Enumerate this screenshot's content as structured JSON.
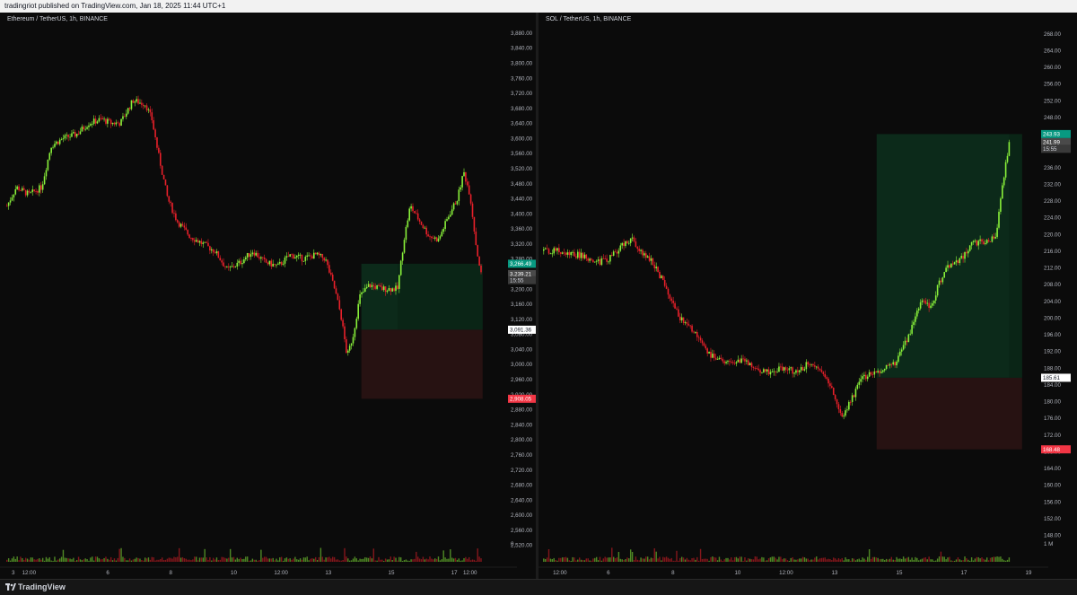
{
  "header": {
    "text": "tradingriot published on TradingView.com, Jan 18, 2025 11:44 UTC+1"
  },
  "footer": {
    "brand": "TradingView"
  },
  "colors": {
    "up": "#89f13a",
    "down": "#e8202a",
    "bg": "#0b0b0b",
    "tp_zone": "#0c2e1c",
    "sl_zone": "#2a1313",
    "axis_text": "#b2b5be"
  },
  "chart_data": [
    {
      "type": "candlestick",
      "title": "Ethereum / TetherUS, 1h, BINANCE",
      "ylim": [
        2480,
        3900
      ],
      "yticks": [
        "3,880.00",
        "3,840.00",
        "3,800.00",
        "3,760.00",
        "3,720.00",
        "3,680.00",
        "3,640.00",
        "3,600.00",
        "3,560.00",
        "3,520.00",
        "3,480.00",
        "3,440.00",
        "3,400.00",
        "3,360.00",
        "3,320.00",
        "3,280.00",
        "3,240.00",
        "3,200.00",
        "3,160.00",
        "3,120.00",
        "3,080.00",
        "3,040.00",
        "3,000.00",
        "2,960.00",
        "2,920.00",
        "2,880.00",
        "2,840.00",
        "2,800.00",
        "2,760.00",
        "2,720.00",
        "2,680.00",
        "2,640.00",
        "2,600.00",
        "2,560.00",
        "2,520.00"
      ],
      "volume_label": "0",
      "xticks": [
        {
          "label": "3",
          "day": 3
        },
        {
          "label": "12:00",
          "day": 3.5
        },
        {
          "label": "6",
          "day": 6
        },
        {
          "label": "8",
          "day": 8
        },
        {
          "label": "10",
          "day": 10
        },
        {
          "label": "12:00",
          "day": 11.5
        },
        {
          "label": "13",
          "day": 13
        },
        {
          "label": "15",
          "day": 15
        },
        {
          "label": "17",
          "day": 17
        },
        {
          "label": "12:00",
          "day": 17.5
        }
      ],
      "x_start_day": 2.75,
      "x_end_day": 17.85,
      "path": [
        [
          2.8,
          3420
        ],
        [
          3.1,
          3470
        ],
        [
          3.5,
          3450
        ],
        [
          3.9,
          3470
        ],
        [
          4.2,
          3580
        ],
        [
          4.6,
          3600
        ],
        [
          5.0,
          3610
        ],
        [
          5.4,
          3640
        ],
        [
          5.8,
          3650
        ],
        [
          6.1,
          3640
        ],
        [
          6.4,
          3640
        ],
        [
          6.8,
          3700
        ],
        [
          7.2,
          3690
        ],
        [
          7.4,
          3650
        ],
        [
          7.6,
          3560
        ],
        [
          7.9,
          3440
        ],
        [
          8.2,
          3380
        ],
        [
          8.6,
          3340
        ],
        [
          9.0,
          3320
        ],
        [
          9.4,
          3300
        ],
        [
          9.8,
          3250
        ],
        [
          10.2,
          3270
        ],
        [
          10.6,
          3300
        ],
        [
          11.0,
          3270
        ],
        [
          11.4,
          3260
        ],
        [
          11.8,
          3290
        ],
        [
          12.2,
          3280
        ],
        [
          12.6,
          3290
        ],
        [
          12.9,
          3280
        ],
        [
          13.2,
          3200
        ],
        [
          13.4,
          3130
        ],
        [
          13.6,
          3020
        ],
        [
          13.8,
          3080
        ],
        [
          14.0,
          3180
        ],
        [
          14.3,
          3210
        ],
        [
          14.7,
          3200
        ],
        [
          15.0,
          3200
        ],
        [
          15.2,
          3200
        ],
        [
          15.4,
          3330
        ],
        [
          15.6,
          3420
        ],
        [
          15.9,
          3380
        ],
        [
          16.2,
          3340
        ],
        [
          16.5,
          3330
        ],
        [
          16.8,
          3390
        ],
        [
          17.1,
          3440
        ],
        [
          17.3,
          3510
        ],
        [
          17.5,
          3450
        ],
        [
          17.7,
          3310
        ],
        [
          17.85,
          3239
        ]
      ],
      "position": {
        "start_day": 14.05,
        "end_day": 17.9,
        "entry": 3091.36,
        "target": 3266.49,
        "stop": 2908.05,
        "split_day": 15.2
      },
      "price_labels": [
        {
          "text": "3,266.49",
          "price": 3266.49,
          "kind": "green"
        },
        {
          "text": "3,239.21",
          "price": 3239.21,
          "kind": "gray"
        },
        {
          "text": "15:55",
          "price": 3223,
          "kind": "gray2"
        },
        {
          "text": "3,091.36",
          "price": 3091.36,
          "kind": "white"
        },
        {
          "text": "2,908.05",
          "price": 2908.05,
          "kind": "red"
        }
      ]
    },
    {
      "type": "candlestick",
      "title": "SOL / TetherUS, 1h, BINANCE",
      "ylim": [
        142,
        270
      ],
      "yticks": [
        "268.00",
        "264.00",
        "260.00",
        "256.00",
        "252.00",
        "248.00",
        "244.00",
        "240.00",
        "236.00",
        "232.00",
        "228.00",
        "224.00",
        "220.00",
        "216.00",
        "212.00",
        "208.00",
        "204.00",
        "200.00",
        "196.00",
        "192.00",
        "188.00",
        "184.00",
        "180.00",
        "176.00",
        "172.00",
        "168.00",
        "164.00",
        "160.00",
        "156.00",
        "152.00",
        "148.00"
      ],
      "volume_label": "1 M",
      "xticks": [
        {
          "label": "12:00",
          "day": 4.5
        },
        {
          "label": "6",
          "day": 6
        },
        {
          "label": "8",
          "day": 8
        },
        {
          "label": "10",
          "day": 10
        },
        {
          "label": "12:00",
          "day": 11.5
        },
        {
          "label": "13",
          "day": 13
        },
        {
          "label": "15",
          "day": 15
        },
        {
          "label": "17",
          "day": 17
        },
        {
          "label": "19",
          "day": 19
        }
      ],
      "x_start_day": 3.95,
      "x_end_day": 18.5,
      "path": [
        [
          4.0,
          216
        ],
        [
          4.4,
          216
        ],
        [
          4.8,
          215
        ],
        [
          5.2,
          215
        ],
        [
          5.6,
          213
        ],
        [
          6.0,
          214
        ],
        [
          6.4,
          217
        ],
        [
          6.7,
          219
        ],
        [
          7.0,
          216
        ],
        [
          7.4,
          213
        ],
        [
          7.8,
          207
        ],
        [
          8.2,
          200
        ],
        [
          8.6,
          197
        ],
        [
          9.0,
          192
        ],
        [
          9.4,
          190
        ],
        [
          9.8,
          189
        ],
        [
          10.2,
          190
        ],
        [
          10.6,
          187
        ],
        [
          11.0,
          187
        ],
        [
          11.4,
          188
        ],
        [
          11.8,
          187
        ],
        [
          12.2,
          189
        ],
        [
          12.6,
          187
        ],
        [
          12.9,
          183
        ],
        [
          13.2,
          176
        ],
        [
          13.5,
          180
        ],
        [
          13.8,
          185
        ],
        [
          14.2,
          187
        ],
        [
          14.6,
          188
        ],
        [
          14.9,
          189
        ],
        [
          15.3,
          196
        ],
        [
          15.7,
          204
        ],
        [
          16.0,
          202
        ],
        [
          16.2,
          208
        ],
        [
          16.5,
          212
        ],
        [
          16.9,
          214
        ],
        [
          17.3,
          218
        ],
        [
          17.7,
          218
        ],
        [
          18.0,
          220
        ],
        [
          18.2,
          232
        ],
        [
          18.4,
          242
        ]
      ],
      "position": {
        "start_day": 14.3,
        "end_day": 18.8,
        "entry": 185.61,
        "target": 243.93,
        "stop": 168.48,
        "split_day": 18.4
      },
      "price_labels": [
        {
          "text": "243.93",
          "price": 243.93,
          "kind": "green"
        },
        {
          "text": "241.99",
          "price": 241.99,
          "kind": "gray"
        },
        {
          "text": "15:55",
          "price": 240.4,
          "kind": "gray2"
        },
        {
          "text": "185.61",
          "price": 185.61,
          "kind": "white"
        },
        {
          "text": "168.48",
          "price": 168.48,
          "kind": "red"
        }
      ]
    }
  ]
}
